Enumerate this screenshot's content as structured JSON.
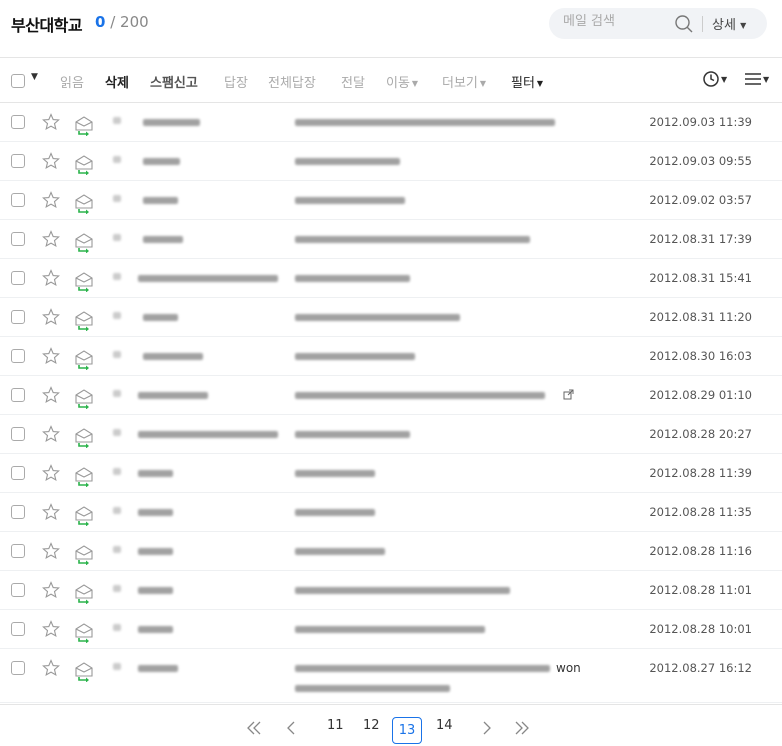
{
  "header": {
    "title": "부산대학교",
    "unread_count": "0",
    "total_count": "/ 200",
    "search_placeholder": "메일 검색",
    "detail_label": "상세"
  },
  "toolbar": {
    "items": [
      "읽음",
      "삭제",
      "스팸신고",
      "답장",
      "전체답장",
      "전달",
      "이동",
      "더보기",
      "필터"
    ]
  },
  "mails": [
    {
      "date": "2012.09.03 11:39"
    },
    {
      "date": "2012.09.03 09:55"
    },
    {
      "date": "2012.09.02 03:57"
    },
    {
      "date": "2012.08.31 17:39"
    },
    {
      "date": "2012.08.31 15:41"
    },
    {
      "date": "2012.08.31 11:20"
    },
    {
      "date": "2012.08.30 16:03"
    },
    {
      "date": "2012.08.29 01:10"
    },
    {
      "date": "2012.08.28 20:27"
    },
    {
      "date": "2012.08.28 11:39"
    },
    {
      "date": "2012.08.28 11:35"
    },
    {
      "date": "2012.08.28 11:16"
    },
    {
      "date": "2012.08.28 11:01"
    },
    {
      "date": "2012.08.28 10:01"
    },
    {
      "date": "2012.08.27 16:12",
      "subject_suffix": "won"
    }
  ],
  "pager": {
    "pages": [
      "11",
      "12",
      "13",
      "14"
    ],
    "current": "13"
  },
  "colors": {
    "accent": "#1a73e8",
    "reply_arrow": "#2bb34b"
  }
}
